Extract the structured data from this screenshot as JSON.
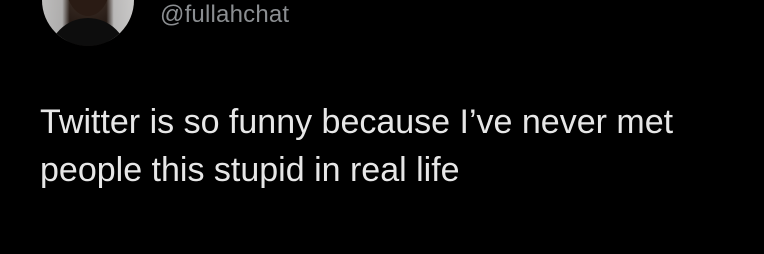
{
  "tweet": {
    "author_handle": "@fullahchat",
    "text": "Twitter is so funny because I’ve never met people this stupid in real life"
  },
  "colors": {
    "background": "#000000",
    "handle": "#8b8e91",
    "text": "#e7e7e7"
  },
  "icons": {
    "avatar": "profile-photo"
  }
}
